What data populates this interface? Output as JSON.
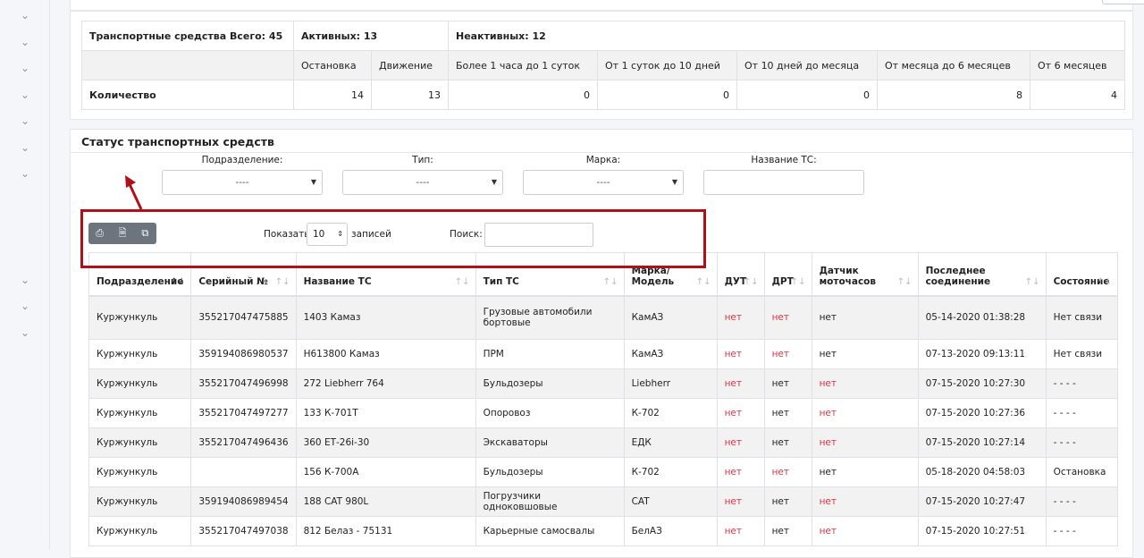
{
  "summary": {
    "total_label": "Транспортные средства Всего: 45",
    "active_label": "Активных: 13",
    "inactive_label": "Неактивных: 12",
    "columns": [
      "Остановка",
      "Движение",
      "Более 1 часа до 1 суток",
      "От 1 суток до 10 дней",
      "От 10 дней до месяца",
      "От месяца до 6 месяцев",
      "От 6 месяцев"
    ],
    "row_label": "Количество",
    "values": [
      "14",
      "13",
      "0",
      "0",
      "0",
      "8",
      "4"
    ]
  },
  "status": {
    "title": "Статус транспортных средств",
    "filters": {
      "division_label": "Подразделение:",
      "division_value": "----",
      "type_label": "Тип:",
      "type_value": "----",
      "brand_label": "Марка:",
      "brand_value": "----",
      "name_label": "Название ТС:"
    },
    "toolbar": {
      "show_label": "Показать",
      "page_length": "10",
      "records_label": "записей",
      "search_label": "Поиск:"
    },
    "table": {
      "headers": [
        "Подразделение",
        "Серийный №",
        "Название ТС",
        "Тип ТС",
        "Марка/ Модель",
        "ДУТ",
        "ДРТ",
        "Датчик моточасов",
        "Последнее соединение",
        "Состояние"
      ],
      "rows": [
        [
          "Куржункуль",
          "355217047475885",
          "1403 Камаз",
          "Грузовые автомобили бортовые",
          "КамАЗ",
          "нет",
          "нет",
          "нет",
          "05-14-2020 01:38:28",
          "Нет связи"
        ],
        [
          "Куржункуль",
          "359194086980537",
          "Н613800 Камаз",
          "ПРМ",
          "КамАЗ",
          "нет",
          "нет",
          "нет",
          "07-13-2020 09:13:11",
          "Нет связи"
        ],
        [
          "Куржункуль",
          "355217047496998",
          "272 Liebherr 764",
          "Бульдозеры",
          "Liebherr",
          "нет",
          "нет",
          "нет",
          "07-15-2020 10:27:30",
          "- - - -"
        ],
        [
          "Куржункуль",
          "355217047497277",
          "133 К-701Т",
          "Опоровоз",
          "К-702",
          "нет",
          "нет",
          "нет",
          "07-15-2020 10:27:36",
          "- - - -"
        ],
        [
          "Куржункуль",
          "355217047496436",
          "360 ЕТ-26i-30",
          "Экскаваторы",
          "ЕДК",
          "нет",
          "нет",
          "нет",
          "07-15-2020 10:27:14",
          "- - - -"
        ],
        [
          "Куржункуль",
          "",
          "156 К-700А",
          "Бульдозеры",
          "К-702",
          "нет",
          "нет",
          "нет",
          "05-18-2020 04:58:03",
          "Остановка"
        ],
        [
          "Куржункуль",
          "359194086989454",
          "188 CAT 980L",
          "Погрузчики одноковшовые",
          "CAT",
          "нет",
          "нет",
          "нет",
          "07-15-2020 10:27:47",
          "- - - -"
        ],
        [
          "Куржункуль",
          "355217047497038",
          "812 Белаз - 75131",
          "Карьерные самосвалы",
          "БелАЗ",
          "нет",
          "нет",
          "нет",
          "07-15-2020 10:27:51",
          "- - - -"
        ]
      ],
      "red_flags": [
        [
          true,
          true,
          false
        ],
        [
          true,
          true,
          false
        ],
        [
          true,
          false,
          true
        ],
        [
          true,
          false,
          true
        ],
        [
          true,
          false,
          true
        ],
        [
          true,
          true,
          false
        ],
        [
          true,
          false,
          true
        ],
        [
          true,
          false,
          true
        ]
      ]
    }
  }
}
